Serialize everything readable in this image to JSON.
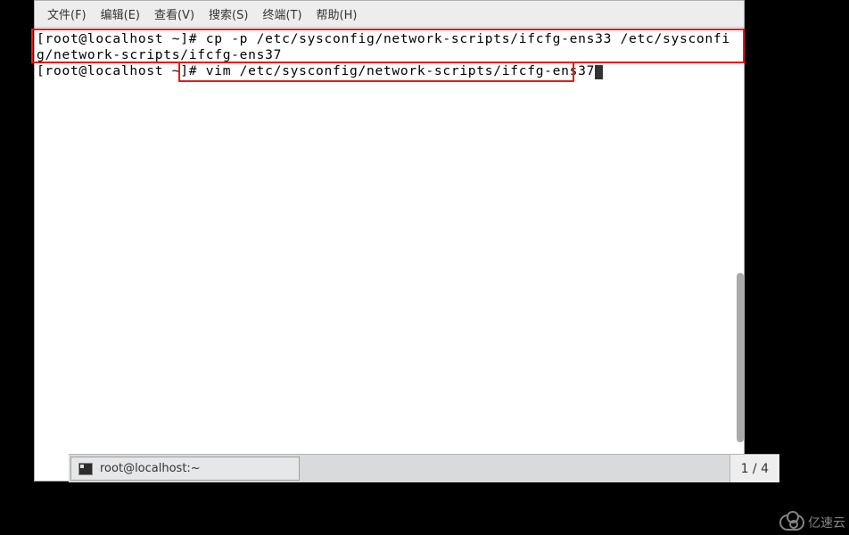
{
  "menu": {
    "file": "文件(F)",
    "edit": "编辑(E)",
    "view": "查看(V)",
    "search": "搜索(S)",
    "term": "终端(T)",
    "help": "帮助(H)"
  },
  "terminal": {
    "line1_prompt": "[root@localhost ~]# ",
    "line1_cmd": "cp -p /etc/sysconfig/network-scripts/ifcfg-ens33 /etc/sysconfig/network-scripts/ifcfg-ens37",
    "line2_prompt": "[root@localhost ~]# ",
    "line2_cmd": "vim /etc/sysconfig/network-scripts/ifcfg-ens37"
  },
  "taskbar": {
    "title": "root@localhost:~"
  },
  "pager": "1 / 4",
  "watermark": "亿速云"
}
